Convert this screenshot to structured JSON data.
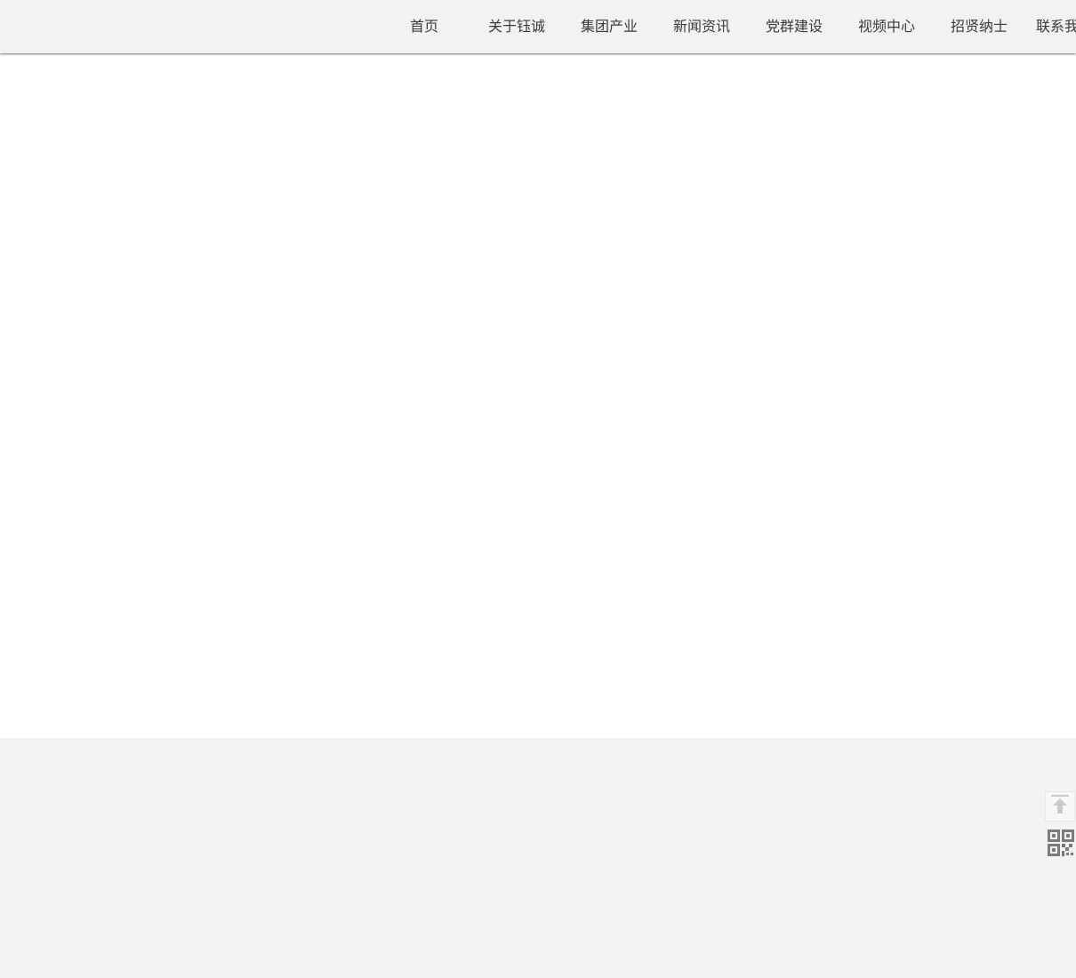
{
  "header": {
    "nav": [
      {
        "label": "首页"
      },
      {
        "label": "关于钰诚"
      },
      {
        "label": "集团产业"
      },
      {
        "label": "新闻资讯"
      },
      {
        "label": "党群建设"
      },
      {
        "label": "视频中心"
      },
      {
        "label": "招贤纳士"
      },
      {
        "label": "联系我们"
      }
    ]
  },
  "floating_tools": {
    "back_to_top_icon": "arrow-up-to-line-icon",
    "qr_icon": "qr-code-icon"
  },
  "colors": {
    "header_bg": "#f2f2f2",
    "footer_bg": "#f2f2f2",
    "nav_text": "#3a3a3a",
    "icon_gray": "#7a7a7a"
  }
}
